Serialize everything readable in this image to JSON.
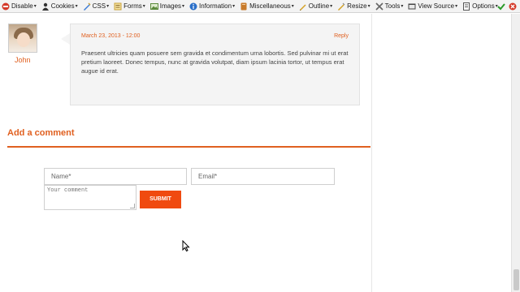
{
  "toolbar": {
    "items": [
      {
        "label": "Disable",
        "icon": "disable-icon",
        "color": "#d43a2a"
      },
      {
        "label": "Cookies",
        "icon": "cookies-icon",
        "color": "#333333"
      },
      {
        "label": "CSS",
        "icon": "css-icon",
        "color": "#3a7bd5"
      },
      {
        "label": "Forms",
        "icon": "forms-icon",
        "color": "#c9a23a"
      },
      {
        "label": "Images",
        "icon": "images-icon",
        "color": "#5a8a3a"
      },
      {
        "label": "Information",
        "icon": "information-icon",
        "color": "#2a6fc9"
      },
      {
        "label": "Miscellaneous",
        "icon": "miscellaneous-icon",
        "color": "#c97a2a"
      },
      {
        "label": "Outline",
        "icon": "outline-icon",
        "color": "#d4a020"
      },
      {
        "label": "Resize",
        "icon": "resize-icon",
        "color": "#d4a020"
      },
      {
        "label": "Tools",
        "icon": "tools-icon",
        "color": "#666666"
      },
      {
        "label": "View Source",
        "icon": "view-source-icon",
        "color": "#444444"
      },
      {
        "label": "Options",
        "icon": "options-icon",
        "color": "#555555"
      }
    ],
    "check_icon": "check-icon",
    "error_icon": "error-icon"
  },
  "comment": {
    "author": "John",
    "date": "March 23, 2013 - 12:00",
    "reply_label": "Reply",
    "text": "Praesent ultricies quam posuere sem gravida et condimentum urna lobortis. Sed pulvinar mi ut erat pretium laoreet. Donec tempus, nunc at gravida volutpat, diam ipsum lacinia tortor, ut tempus erat augue id erat."
  },
  "form": {
    "title": "Add a comment",
    "name_placeholder": "Name*",
    "email_placeholder": "Email*",
    "comment_placeholder": "Your comment",
    "submit_label": "SUBMIT"
  },
  "colors": {
    "accent": "#e06020",
    "submit": "#f04a10"
  }
}
